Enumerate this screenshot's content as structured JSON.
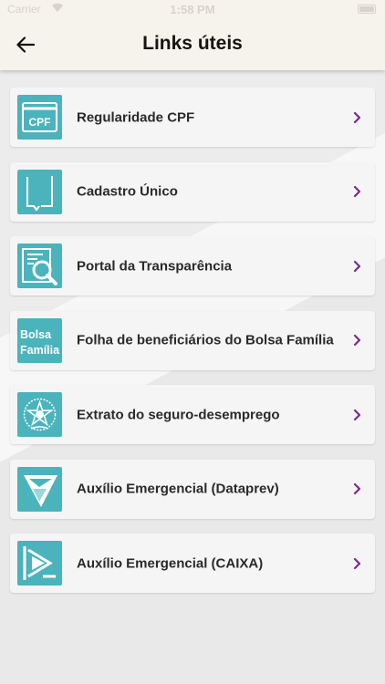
{
  "status": {
    "carrier": "Carrier",
    "time": "1:58 PM"
  },
  "header": {
    "title": "Links úteis",
    "back_icon": "arrow-left-icon"
  },
  "colors": {
    "accent": "#7b2a8c",
    "icon_bg": "#4bb3bc"
  },
  "links": [
    {
      "label": "Regularidade CPF",
      "icon": "cpf-card-icon",
      "icon_text": "CPF"
    },
    {
      "label": "Cadastro Único",
      "icon": "cadastro-unico-icon"
    },
    {
      "label": "Portal da Transparência",
      "icon": "document-search-icon"
    },
    {
      "label": "Folha de beneficiários do Bolsa Família",
      "icon": "bolsa-familia-icon",
      "icon_text_1": "Bolsa",
      "icon_text_2": "Família"
    },
    {
      "label": "Extrato do seguro-desemprego",
      "icon": "brasao-republica-icon"
    },
    {
      "label": "Auxílio Emergencial (Dataprev)",
      "icon": "dataprev-logo-icon"
    },
    {
      "label": "Auxílio Emergencial (CAIXA)",
      "icon": "caixa-logo-icon"
    }
  ]
}
